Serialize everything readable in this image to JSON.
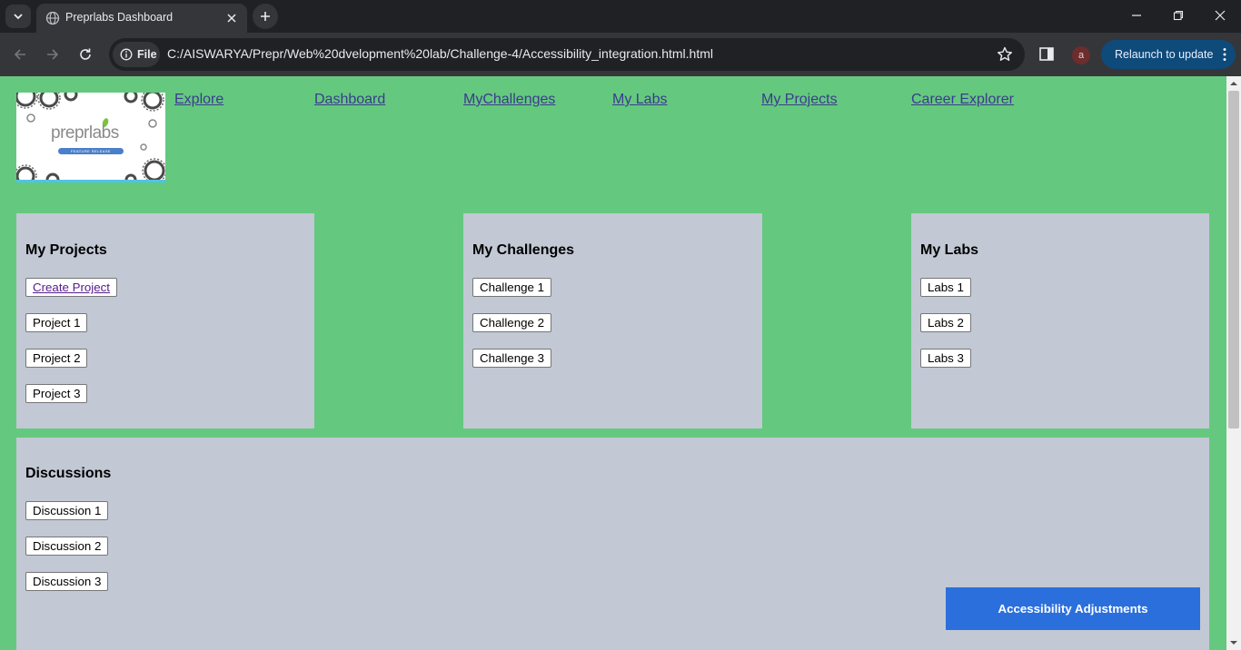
{
  "browser": {
    "tab_title": "Preprlabs Dashboard",
    "chip_label": "File",
    "url": "C:/AISWARYA/Prepr/Web%20dvelopment%20lab/Challenge-4/Accessibility_integration.html.html",
    "profile_initial": "a",
    "relaunch_label": "Relaunch to update"
  },
  "logo": {
    "wordmark": "preprlabs",
    "tagline": "FEATURE RELEASE"
  },
  "nav": {
    "links": [
      "Explore",
      "Dashboard",
      "MyChallenges",
      "My Labs",
      "My Projects",
      "Career Explorer"
    ]
  },
  "projects": {
    "title": "My Projects",
    "create_label": "Create Project",
    "items": [
      "Project 1",
      "Project 2",
      "Project 3"
    ]
  },
  "challenges": {
    "title": "My Challenges",
    "items": [
      "Challenge 1",
      "Challenge 2",
      "Challenge 3"
    ]
  },
  "labs": {
    "title": "My Labs",
    "items": [
      "Labs 1",
      "Labs 2",
      "Labs 3"
    ]
  },
  "discussions": {
    "title": "Discussions",
    "items": [
      "Discussion 1",
      "Discussion 2",
      "Discussion 3"
    ]
  },
  "accessibility": {
    "button_label": "Accessibility Adjustments"
  },
  "colors": {
    "page_background": "#64c97e",
    "card_background": "#c2c8d4",
    "accessibility_button": "#2b6fdc",
    "relaunch_button": "#0e4a7a"
  },
  "icons": {
    "tab_menu": "chevron-down-icon",
    "favicon": "globe-icon",
    "tab_close": "close-icon",
    "new_tab": "plus-icon",
    "back": "arrow-left-icon",
    "forward": "arrow-right-icon",
    "reload": "reload-icon",
    "site_info": "info-icon",
    "bookmark": "star-icon",
    "side_panel": "side-panel-icon",
    "menu": "more-vertical-icon"
  }
}
